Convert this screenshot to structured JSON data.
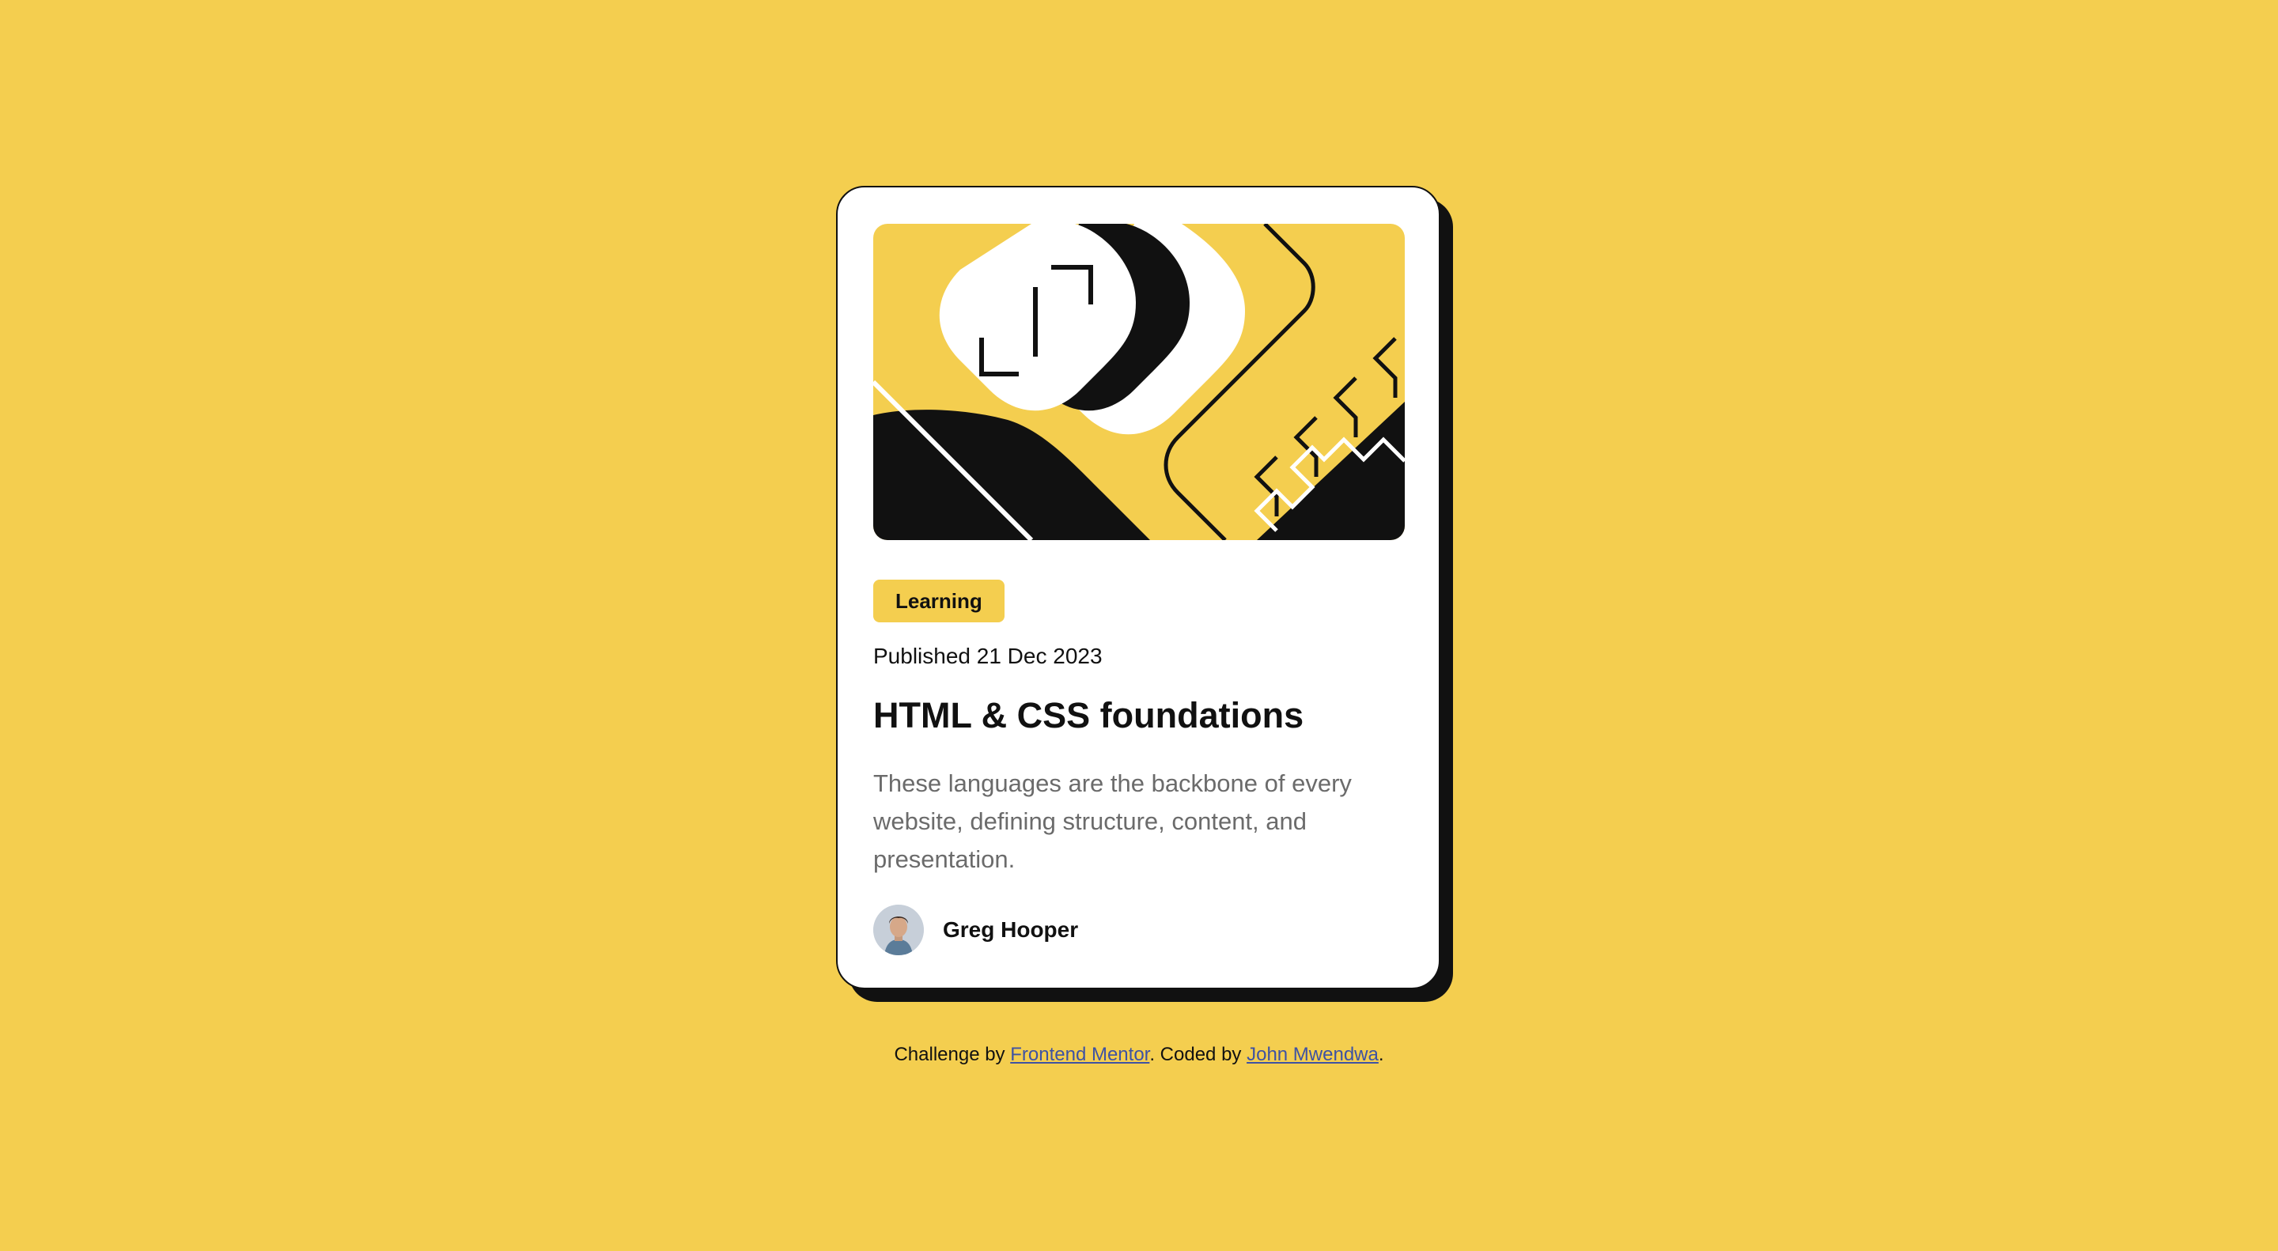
{
  "colors": {
    "background": "#F4CE4F",
    "card": "#FFFFFF",
    "ink": "#111111",
    "muted_text": "#6B6B6B",
    "link": "#3E52A3"
  },
  "card": {
    "illustration_icon": "abstract-code-illustration",
    "tag": "Learning",
    "published": "Published 21 Dec 2023",
    "title": "HTML & CSS foundations",
    "description": "These languages are the backbone of every website, defining structure, content, and presentation.",
    "author": {
      "avatar_icon": "person-avatar",
      "name": "Greg Hooper"
    }
  },
  "attribution": {
    "prefix": "Challenge by",
    "challenge_link": "Frontend Mentor",
    "middle": ". Coded by",
    "author_link": "John Mwendwa",
    "suffix": "."
  }
}
